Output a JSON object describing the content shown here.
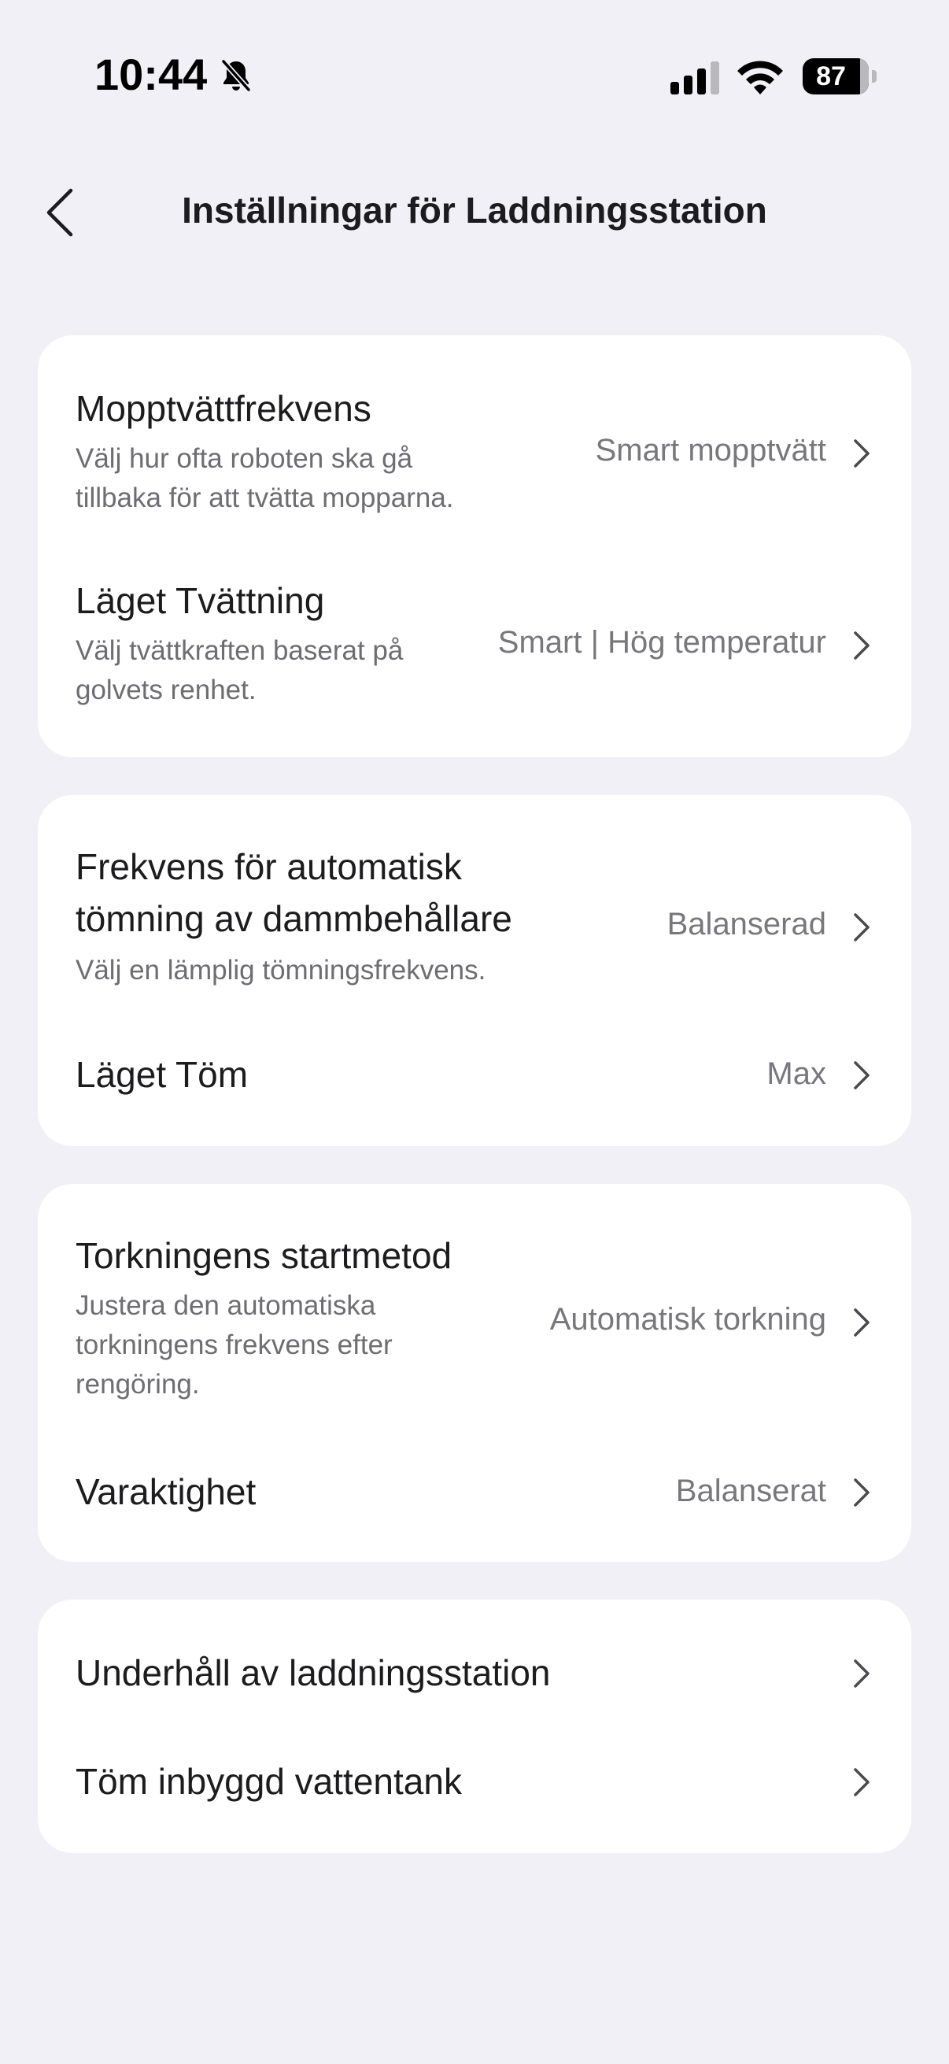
{
  "status_bar": {
    "time": "10:44",
    "battery_level": "87",
    "battery_fraction": 0.87,
    "icons": [
      "bell-slash-icon",
      "cellular-signal-icon",
      "wifi-icon",
      "battery-icon"
    ]
  },
  "nav": {
    "back_icon": "chevron-left-icon",
    "title": "Inställningar för Laddningsstation"
  },
  "sections": [
    {
      "rows": [
        {
          "title": "Mopptvättfrekvens",
          "description_lines": [
            "Välj hur ofta roboten ska gå",
            "tillbaka för att tvätta mopparna."
          ],
          "value": "Smart mopptvätt"
        },
        {
          "title": "Läget Tvättning",
          "description_lines": [
            "Välj tvättkraften baserat på",
            "golvets renhet."
          ],
          "value": "Smart | Hög temperatur"
        }
      ]
    },
    {
      "rows": [
        {
          "title_lines": [
            "Frekvens för automatisk",
            "tömning av dammbehållare"
          ],
          "description_lines": [
            "Välj en lämplig tömningsfrekvens."
          ],
          "value": "Balanserad"
        },
        {
          "title": "Läget Töm",
          "value": "Max"
        }
      ]
    },
    {
      "rows": [
        {
          "title": "Torkningens startmetod",
          "description_lines": [
            "Justera den automatiska",
            "torkningens frekvens efter",
            "rengöring."
          ],
          "value": "Automatisk torkning"
        },
        {
          "title": "Varaktighet",
          "value": "Balanserat"
        }
      ]
    },
    {
      "rows": [
        {
          "title": "Underhåll av laddningsstation"
        },
        {
          "title": "Töm inbyggd vattentank"
        }
      ]
    }
  ],
  "colors": {
    "background": "#f1f0f6",
    "card": "#ffffff",
    "primary_text": "#1c1c1e",
    "secondary_text": "#6d6d72",
    "value_text": "#77777c",
    "chevron": "#4a4a4e"
  }
}
